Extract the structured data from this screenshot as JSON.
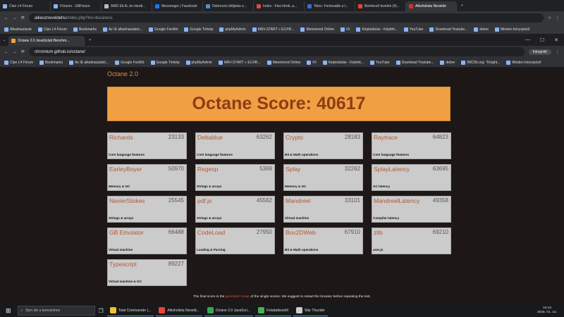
{
  "browser_top": {
    "tabs": [
      {
        "label": "Clan L4 Fórum",
        "color": "#8ab4f8"
      },
      {
        "label": "Fórums - G8Fórum",
        "color": "#8ab4f8"
      },
      {
        "label": "AMD Ek-lit, és mindi...",
        "color": "#bbbbbb"
      },
      {
        "label": "Messenger | Facebook",
        "color": "#1877f2"
      },
      {
        "label": "Debrecen időjárás e...",
        "color": "#4a90d9"
      },
      {
        "label": "Index - friss hírek, a...",
        "color": "#e34b3b"
      },
      {
        "label": "Telex: Fontosabb a l...",
        "color": "#2f6fd8"
      },
      {
        "label": "Beérkező levelek (4)...",
        "color": "#ea4335"
      },
      {
        "label": "Alkoholista Nevelde",
        "color": "#d93025",
        "active": true
      }
    ],
    "url_domain": "alkeszneveldehu",
    "url_path": "/index.php?inc=business",
    "bookmarks": [
      "Alkalmazások",
      "Clan L4 Fórum",
      "Bookmarks",
      "Az IE alkalmazásbó...",
      "Google Fordító",
      "Google Térkép",
      "phpMyAdmin",
      "MÁV-START » ELVIR...",
      "Menetrend Online",
      "Fil",
      "Képkódolás - Képfelt...",
      "YouTube",
      "Download Youtube...",
      "debre",
      "Minden könyvjelző"
    ]
  },
  "browser_inner": {
    "tab_label": "Octane 2.0 JavaScript Benchm...",
    "url": "chromium.github.io/octane/",
    "incognito_label": "Inkognitó",
    "bookmarks": [
      "Clan L4 Fórum",
      "Bookmarks",
      "Az IE alkalmazásbó...",
      "Google Fordító",
      "Google Térkép",
      "phpMyAdmin",
      "MÁV-START » ELVIR...",
      "Menetrend Online",
      "Fil",
      "Képkódolás - Képfelt...",
      "YouTube",
      "Download Youtube...",
      "debre",
      "IMCDb.org: \"Knight...",
      "Minden könyvjelző"
    ]
  },
  "octane": {
    "app_title": "Octane 2.0",
    "score_text": "Octane Score: 40617",
    "benchmarks": [
      {
        "name": "Richards",
        "value": "23133",
        "category": "Core language features"
      },
      {
        "name": "Deltablue",
        "value": "63262",
        "category": "Core language features"
      },
      {
        "name": "Crypto",
        "value": "28183",
        "category": "Bit & Math operations"
      },
      {
        "name": "Raytrace",
        "value": "64823",
        "category": "Core language features"
      },
      {
        "name": "EarleyBoyer",
        "value": "50970",
        "category": "Memory & GC"
      },
      {
        "name": "Regexp",
        "value": "5369",
        "category": "Strings & arrays"
      },
      {
        "name": "Splay",
        "value": "32262",
        "category": "Memory & GC"
      },
      {
        "name": "SplayLatency",
        "value": "63695",
        "category": "GC latency"
      },
      {
        "name": "NavierStokes",
        "value": "25545",
        "category": "Strings & arrays"
      },
      {
        "name": "pdf.js",
        "value": "45562",
        "category": "Strings & arrays"
      },
      {
        "name": "Mandreel",
        "value": "33101",
        "category": "Virtual machine"
      },
      {
        "name": "MandreelLatency",
        "value": "49358",
        "category": "Compiler latency"
      },
      {
        "name": "GB Emulator",
        "value": "66488",
        "category": "Virtual machine"
      },
      {
        "name": "CodeLoad",
        "value": "27950",
        "category": "Loading & Parsing"
      },
      {
        "name": "Box2DWeb",
        "value": "67910",
        "category": "Bit & Math operations"
      },
      {
        "name": "zlib",
        "value": "69210",
        "category": "asm.js"
      },
      {
        "name": "Typescript",
        "value": "89227",
        "category": "Virtual machine & GC"
      }
    ],
    "footnote_before": "The final score is the ",
    "footnote_link": "geometric mean",
    "footnote_after": " of the single scores. We suggest to restart the browser before repeating the test."
  },
  "taskbar": {
    "search_placeholder": "Írjon ide a kereséshez",
    "apps": [
      {
        "label": "Total Commander (...",
        "color": "#f2c12e"
      },
      {
        "label": "Alkoholista Neveld...",
        "color": "#ea4335"
      },
      {
        "label": "Octane 2.0 JavaScri...",
        "color": "#34a853"
      },
      {
        "label": "Feladatkezelő",
        "color": "#4caf50"
      },
      {
        "label": "War Thunder",
        "color": "#cccccc"
      }
    ],
    "time": "15:16",
    "date": "2025. 01. 14."
  }
}
